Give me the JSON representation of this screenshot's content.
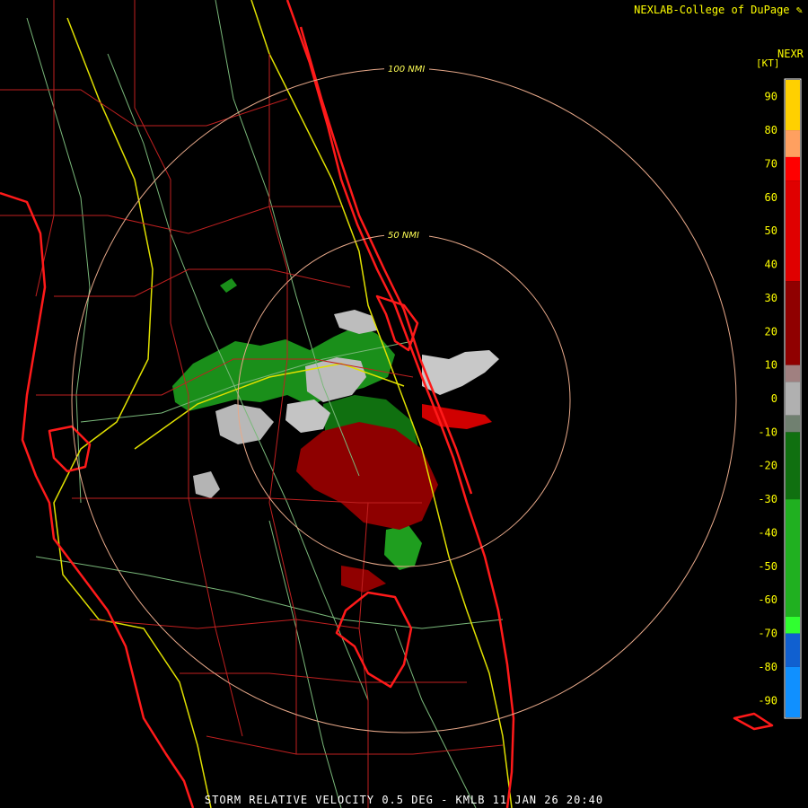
{
  "header": {
    "credit": "NEXLAB-College of DuPage"
  },
  "footer": {
    "caption": "STORM RELATIVE VELOCITY 0.5 DEG - KMLB 11 JAN 26 20:40"
  },
  "map": {
    "range_rings": [
      {
        "label": "100 NMI",
        "nmi": 100
      },
      {
        "label": "50 NMI",
        "nmi": 50
      }
    ],
    "colors": {
      "ring": "#e8a98a",
      "coast": "#ff1a1a",
      "county": "#c02020",
      "highway": "#e0e000",
      "road": "#7ab87a"
    }
  },
  "legend": {
    "product": "NEXR",
    "unit": "[KT]",
    "ticks": [
      "90",
      "80",
      "70",
      "60",
      "50",
      "40",
      "30",
      "20",
      "10",
      "0",
      "-10",
      "-20",
      "-30",
      "-40",
      "-50",
      "-60",
      "-70",
      "-80",
      "-90"
    ],
    "colorbar": [
      {
        "from": 95,
        "to": 80,
        "color": "#ffd000"
      },
      {
        "from": 80,
        "to": 72,
        "color": "#ffa060"
      },
      {
        "from": 72,
        "to": 65,
        "color": "#ff0000"
      },
      {
        "from": 65,
        "to": 35,
        "color": "#e00000"
      },
      {
        "from": 35,
        "to": 10,
        "color": "#900000"
      },
      {
        "from": 10,
        "to": 5,
        "color": "#a08080"
      },
      {
        "from": 5,
        "to": -5,
        "color": "#b0b0b0"
      },
      {
        "from": -5,
        "to": -10,
        "color": "#708070"
      },
      {
        "from": -10,
        "to": -30,
        "color": "#107010"
      },
      {
        "from": -30,
        "to": -65,
        "color": "#20b020"
      },
      {
        "from": -65,
        "to": -70,
        "color": "#30ff30"
      },
      {
        "from": -70,
        "to": -80,
        "color": "#1060d0"
      },
      {
        "from": -80,
        "to": -95,
        "color": "#1090ff"
      }
    ]
  }
}
